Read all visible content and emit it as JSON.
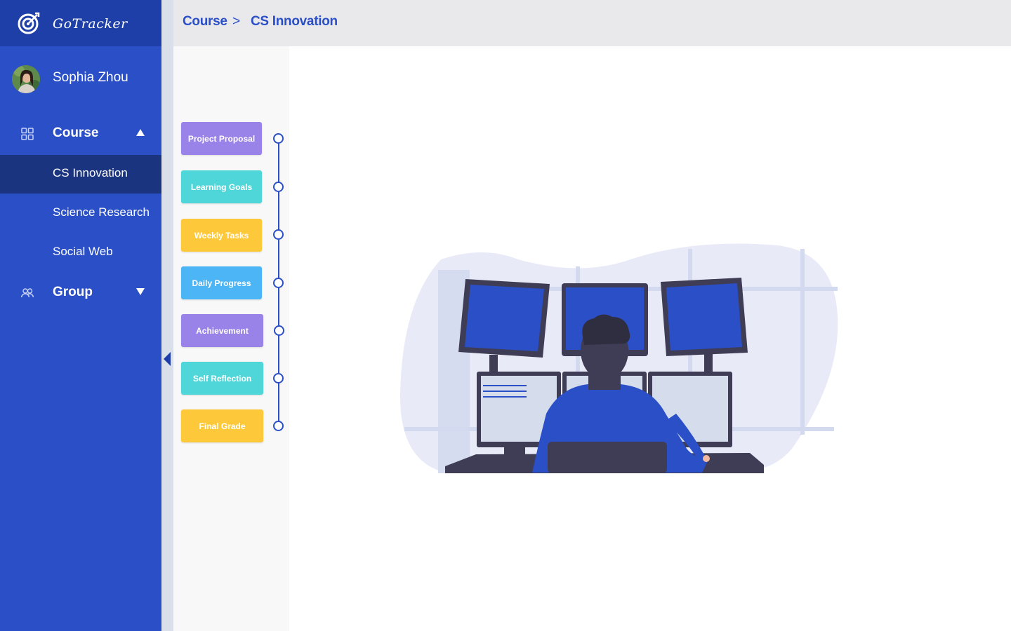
{
  "brand": {
    "name": "GoTracker",
    "icon": "target-icon"
  },
  "user": {
    "name": "Sophia Zhou"
  },
  "nav": {
    "course": {
      "label": "Course",
      "icon": "grid-icon",
      "caret": "caret-up-icon"
    },
    "course_items": [
      {
        "label": "CS Innovation",
        "active": true
      },
      {
        "label": "Science Research",
        "active": false
      },
      {
        "label": "Social Web",
        "active": false
      }
    ],
    "group": {
      "label": "Group",
      "icon": "people-icon",
      "caret": "caret-down-icon"
    }
  },
  "breadcrumb": {
    "parent": "Course",
    "separator": ">",
    "current": "CS Innovation"
  },
  "steps": [
    {
      "label": "Project Proposal",
      "color": "#9a83e8"
    },
    {
      "label": "Learning Goals",
      "color": "#4fd6d8"
    },
    {
      "label": "Weekly Tasks",
      "color": "#fdc93a"
    },
    {
      "label": "Daily Progress",
      "color": "#4cb5f5"
    },
    {
      "label": "Achievement",
      "color": "#9a83e8"
    },
    {
      "label": "Self Reflection",
      "color": "#4fd6d8"
    },
    {
      "label": "Final Grade",
      "color": "#fdc93a"
    }
  ],
  "colors": {
    "sidebar": "#2a4fc7",
    "sidebar_dark": "#1b347f",
    "accent": "#2a4fc7"
  }
}
